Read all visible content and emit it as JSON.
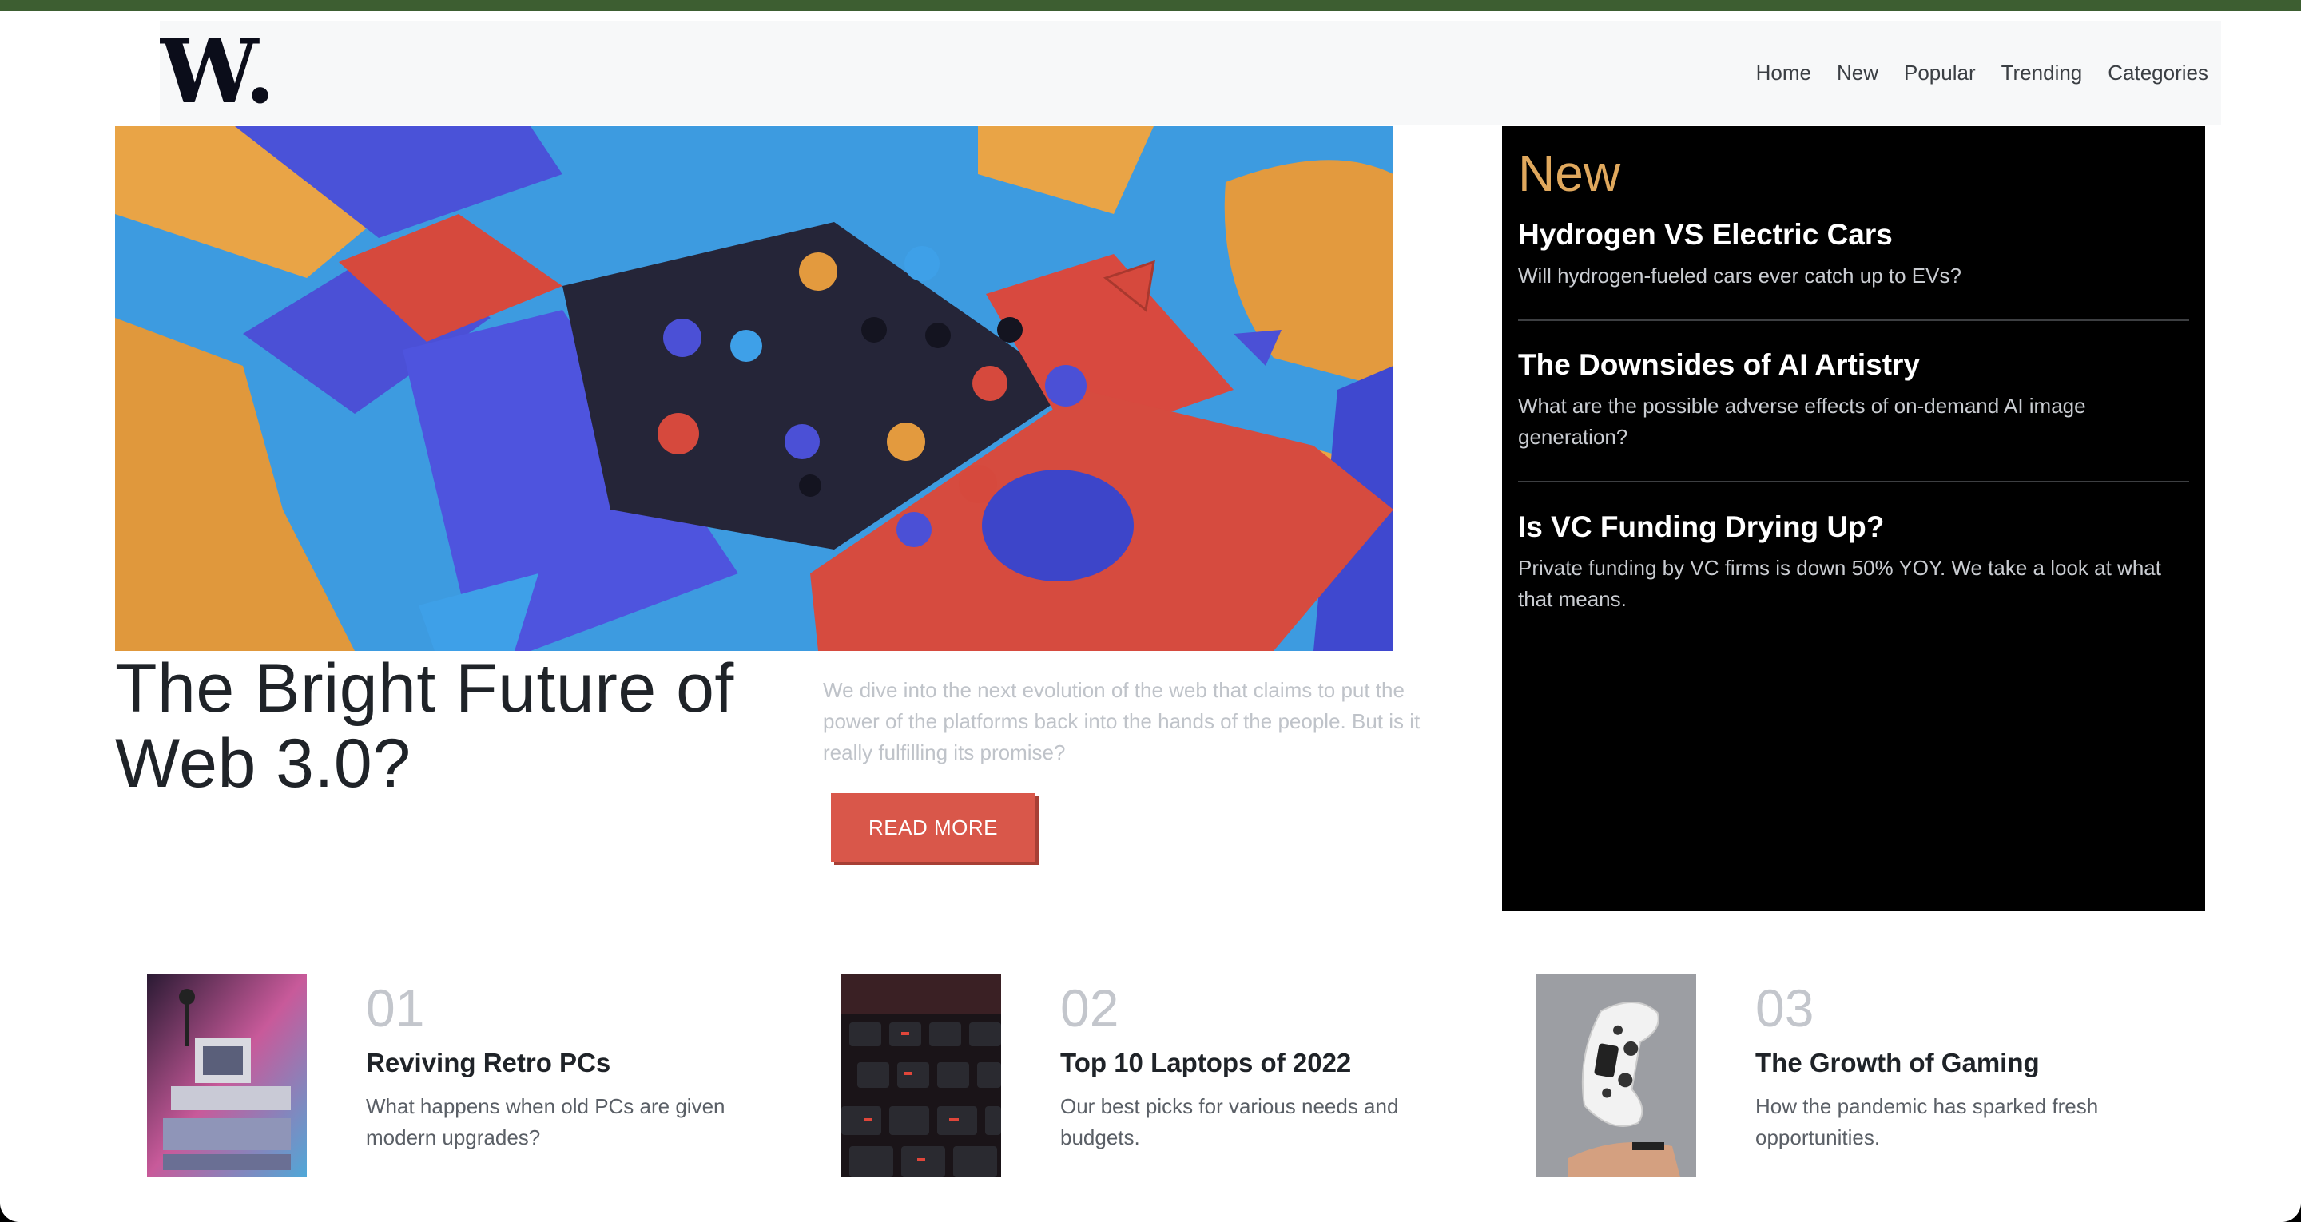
{
  "navbar": {
    "logo_text": "W.",
    "links": [
      "Home",
      "New",
      "Popular",
      "Trending",
      "Categories"
    ]
  },
  "hero": {
    "title": "The Bright Future of Web 3.0?",
    "description": "We dive into the next evolution of the web that claims to put the power of the platforms back into the hands of the people. But is it really fulfilling its promise?",
    "button_label": "READ MORE"
  },
  "new_panel": {
    "heading": "New",
    "items": [
      {
        "title": "Hydrogen VS Electric Cars",
        "desc": "Will hydrogen-fueled cars ever catch up to EVs?"
      },
      {
        "title": "The Downsides of AI Artistry",
        "desc": "What are the possible adverse effects of on-demand AI image generation?"
      },
      {
        "title": "Is VC Funding Drying Up?",
        "desc": "Private funding by VC firms is down 50% YOY. We take a look at what that means."
      }
    ]
  },
  "cards": [
    {
      "num": "01",
      "title": "Reviving Retro PCs",
      "desc": "What happens when old PCs are given modern upgrades?"
    },
    {
      "num": "02",
      "title": "Top 10 Laptops of 2022",
      "desc": "Our best picks for various needs and budgets."
    },
    {
      "num": "03",
      "title": "The Growth of Gaming",
      "desc": "How the pandemic has sparked fresh opportunities."
    }
  ],
  "colors": {
    "top_bar": "#3d5e31",
    "accent_new": "#e0a85d",
    "button": "#d9574a"
  }
}
